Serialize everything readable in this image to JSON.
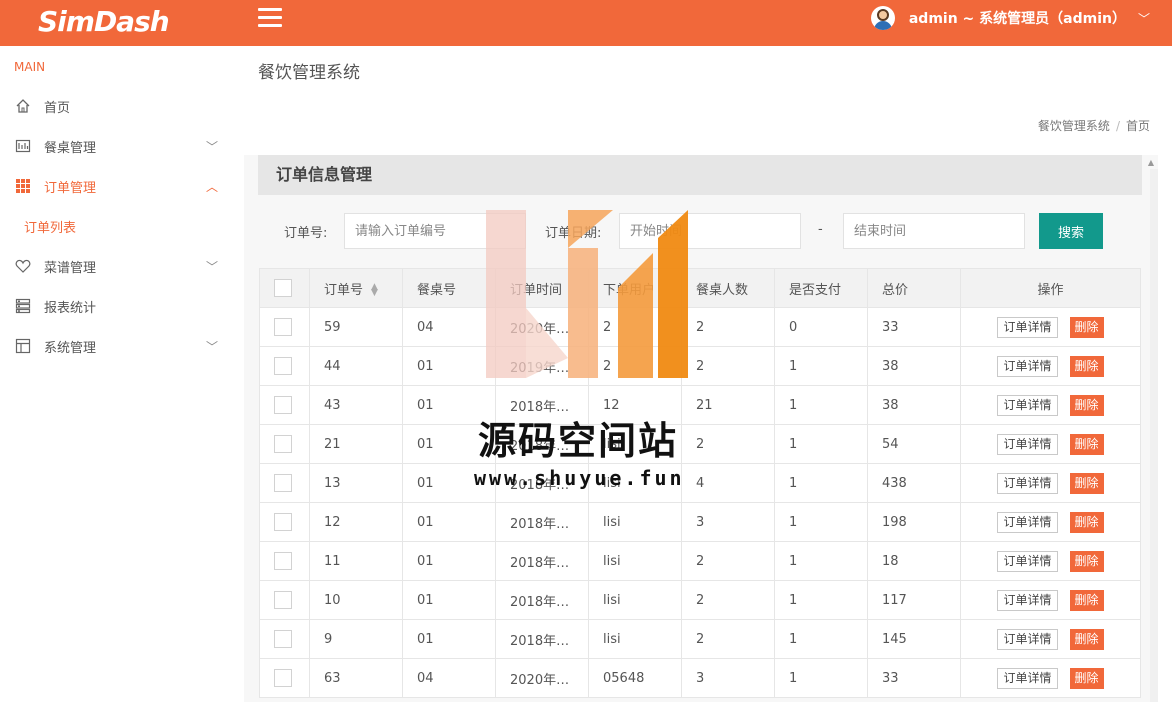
{
  "brand": {
    "logo": "SimDash",
    "color": "#f1683a"
  },
  "header": {
    "user_label": "admin ~ 系统管理员（admin）"
  },
  "sidebar": {
    "section": "MAIN",
    "items": [
      {
        "label": "首页",
        "icon": "home-icon"
      },
      {
        "label": "餐桌管理",
        "icon": "table-icon"
      },
      {
        "label": "订单管理",
        "icon": "grid-icon"
      },
      {
        "label": "菜谱管理",
        "icon": "heart-icon"
      },
      {
        "label": "报表统计",
        "icon": "chart-icon"
      },
      {
        "label": "系统管理",
        "icon": "layout-icon"
      }
    ],
    "sub_item": "订单列表"
  },
  "page": {
    "title": "餐饮管理系统",
    "breadcrumb": [
      "餐饮管理系统",
      "首页"
    ]
  },
  "panel": {
    "title": "订单信息管理"
  },
  "filters": {
    "order_label": "订单号:",
    "order_placeholder": "请输入订单编号",
    "date_label": "订单日期:",
    "start_placeholder": "开始时间",
    "dash": "-",
    "end_placeholder": "结束时间",
    "search_label": "搜索",
    "search_color": "#12998c"
  },
  "table": {
    "headers": [
      "订单号",
      "餐桌号",
      "订单时间",
      "下单用户",
      "餐桌人数",
      "是否支付",
      "总价",
      "操作"
    ],
    "detail_label": "订单详情",
    "delete_label": "删除",
    "rows": [
      {
        "id": "59",
        "table": "04",
        "time": "2020年…",
        "user": "2",
        "people": "2",
        "paid": "0",
        "total": "33"
      },
      {
        "id": "44",
        "table": "01",
        "time": "2019年…",
        "user": "2",
        "people": "2",
        "paid": "1",
        "total": "38"
      },
      {
        "id": "43",
        "table": "01",
        "time": "2018年…",
        "user": "12",
        "people": "21",
        "paid": "1",
        "total": "38"
      },
      {
        "id": "21",
        "table": "01",
        "time": "2018年…",
        "user": "lisi",
        "people": "2",
        "paid": "1",
        "total": "54"
      },
      {
        "id": "13",
        "table": "01",
        "time": "2018年…",
        "user": "lisi",
        "people": "4",
        "paid": "1",
        "total": "438"
      },
      {
        "id": "12",
        "table": "01",
        "time": "2018年…",
        "user": "lisi",
        "people": "3",
        "paid": "1",
        "total": "198"
      },
      {
        "id": "11",
        "table": "01",
        "time": "2018年…",
        "user": "lisi",
        "people": "2",
        "paid": "1",
        "total": "18"
      },
      {
        "id": "10",
        "table": "01",
        "time": "2018年…",
        "user": "lisi",
        "people": "2",
        "paid": "1",
        "total": "117"
      },
      {
        "id": "9",
        "table": "01",
        "time": "2018年…",
        "user": "lisi",
        "people": "2",
        "paid": "1",
        "total": "145"
      },
      {
        "id": "63",
        "table": "04",
        "time": "2020年…",
        "user": "05648",
        "people": "3",
        "paid": "1",
        "total": "33"
      }
    ]
  },
  "watermark": {
    "title": "源码空间站",
    "url": "www.shuyue.fun"
  }
}
